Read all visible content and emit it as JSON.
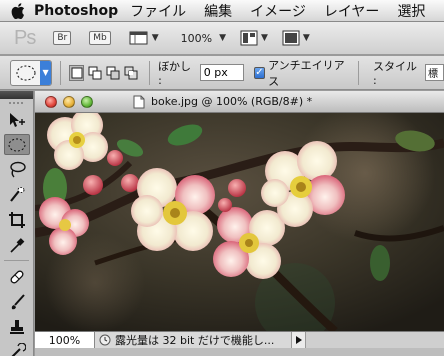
{
  "menubar": {
    "app_name": "Photoshop",
    "items": [
      "ファイル",
      "編集",
      "イメージ",
      "レイヤー",
      "選択"
    ]
  },
  "appbar": {
    "logo": "Ps",
    "bridge_label": "Br",
    "minibridge_label": "Mb",
    "zoom_value": "100%"
  },
  "options": {
    "feather_label": "ぼかし :",
    "feather_value": "0 px",
    "antialias_label": "アンチエイリアス",
    "antialias_checked": true,
    "style_label": "スタイル :",
    "style_value": "標"
  },
  "document": {
    "title": "boke.jpg @ 100% (RGB/8#) *",
    "zoom": "100%",
    "status_text": "露光量は 32 bit だけで機能し..."
  },
  "colors": {
    "accent": "#3b7fd9"
  },
  "icons": {
    "apple": "apple-icon",
    "tools": [
      "move-tool-icon",
      "marquee-tool-icon",
      "lasso-tool-icon",
      "quick-select-icon",
      "crop-tool-icon",
      "eyedropper-icon",
      "healing-brush-icon",
      "brush-tool-icon",
      "stamp-tool-icon",
      "history-brush-icon"
    ]
  }
}
